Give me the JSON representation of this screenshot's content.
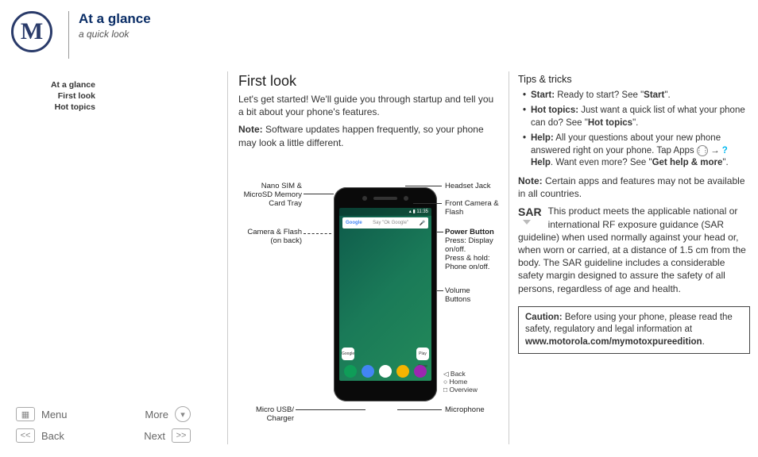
{
  "header": {
    "title": "At a glance",
    "subtitle": "a quick look"
  },
  "nav": {
    "items": [
      "At a glance",
      "First look",
      "Hot topics"
    ]
  },
  "footer": {
    "menu": "Menu",
    "more": "More",
    "back": "Back",
    "next": "Next"
  },
  "first_look": {
    "heading": "First look",
    "intro": "Let's get started! We'll guide you through startup and tell you a bit about your phone's features.",
    "note_label": "Note:",
    "note_text": " Software updates happen frequently, so your phone may look a little different."
  },
  "phone": {
    "status_time": "11:35",
    "search_left": "Google",
    "search_placeholder": "Say \"Ok Google\"",
    "labels": {
      "sim": "Nano SIM & MicroSD Memory Card Tray",
      "camera_flash": "Camera & Flash",
      "on_back": "(on back)",
      "headset": "Headset Jack",
      "front_cam": "Front Camera & Flash",
      "power": "Power Button",
      "power_press": "Press: Display on/off.",
      "power_hold": "Press & hold: Phone on/off.",
      "volume": "Volume Buttons",
      "usb": "Micro USB/ Charger",
      "mic": "Microphone",
      "nav_back": "◁ Back",
      "nav_home": "○ Home",
      "nav_overview": "□ Overview"
    },
    "dock_apps": {
      "google": "Google",
      "playstore": "Play Store"
    }
  },
  "tips": {
    "heading": "Tips & tricks",
    "start_label": "Start:",
    "start_text": " Ready to start? See \"",
    "start_link": "Start",
    "hot_label": "Hot topics:",
    "hot_text": " Just want a quick list of what your phone can do? See \"",
    "hot_link": "Hot topics",
    "help_label": "Help:",
    "help_text_a": " All your questions about your new phone answered right on your phone. Tap Apps ",
    "help_text_b": " → ",
    "help_word": " Help",
    "help_text_c": ". Want even more? See \"",
    "help_link": "Get help & more",
    "note_label": "Note:",
    "note_text": " Certain apps and features may not be available in all countries.",
    "sar_label": "SAR",
    "sar_text": "This product meets the applicable national or international RF exposure guidance (SAR guideline) when used normally against your head or, when worn or carried, at a distance of 1.5 cm from the body. The SAR guideline includes a considerable safety margin designed to assure the safety of all persons, regardless of age and health.",
    "caution_label": "Caution:",
    "caution_text": " Before using your phone, please read the safety, regulatory and legal information at ",
    "caution_url": "www.motorola.com/mymotoxpureedition",
    "period": "."
  },
  "close_quote": "\"."
}
